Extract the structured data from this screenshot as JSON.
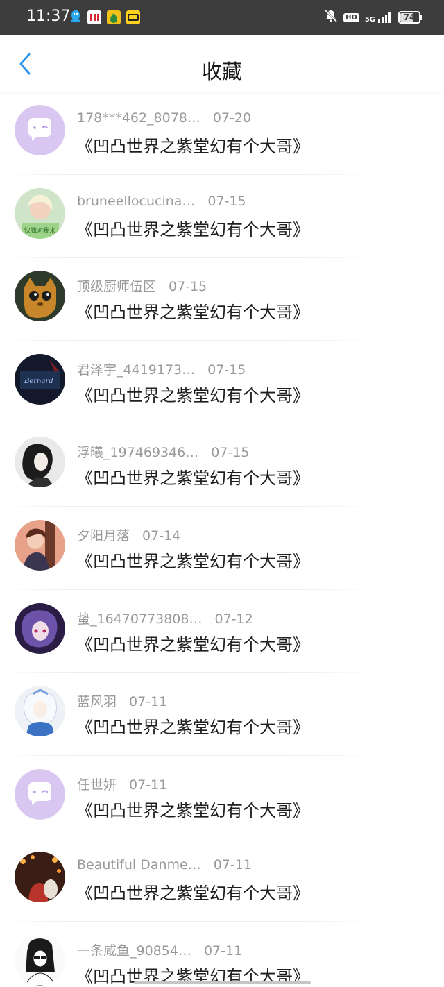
{
  "status_bar": {
    "time": "11:37",
    "hd": "HD",
    "network": "5G",
    "battery": "74",
    "battery_level": 74,
    "app_icons": [
      "qq-icon",
      "kfc-icon",
      "pear-app-icon",
      "kuaikan-icon"
    ]
  },
  "header": {
    "title": "收藏",
    "back_icon": "chevron-left-icon",
    "accent_color": "#2f95e8"
  },
  "list": {
    "items": [
      {
        "user": "178***462_8078…",
        "date": "07-20",
        "book": "《凹凸世界之紫堂幻有个大哥》",
        "avatar": "default-chat-avatar"
      },
      {
        "user": "bruneellocucina…",
        "date": "07-15",
        "book": "《凹凸世界之紫堂幻有个大哥》",
        "avatar": "photo-avatar"
      },
      {
        "user": "顶级厨师伍区",
        "date": "07-15",
        "book": "《凹凸世界之紫堂幻有个大哥》",
        "avatar": "cat-avatar"
      },
      {
        "user": "君泽宇_4419173…",
        "date": "07-15",
        "book": "《凹凸世界之紫堂幻有个大哥》",
        "avatar": "dark-card-avatar"
      },
      {
        "user": "浮曦_197469346…",
        "date": "07-15",
        "book": "《凹凸世界之紫堂幻有个大哥》",
        "avatar": "anime-bw-avatar"
      },
      {
        "user": "夕阳月落",
        "date": "07-14",
        "book": "《凹凸世界之紫堂幻有个大哥》",
        "avatar": "anime-sunset-avatar"
      },
      {
        "user": "蛰_16470773808…",
        "date": "07-12",
        "book": "《凹凸世界之紫堂幻有个大哥》",
        "avatar": "anime-purple-avatar"
      },
      {
        "user": "蓝风羽",
        "date": "07-11",
        "book": "《凹凸世界之紫堂幻有个大哥》",
        "avatar": "anime-white-avatar"
      },
      {
        "user": "任世妍",
        "date": "07-11",
        "book": "《凹凸世界之紫堂幻有个大哥》",
        "avatar": "default-chat-avatar"
      },
      {
        "user": "Beautiful Danme…",
        "date": "07-11",
        "book": "《凹凸世界之紫堂幻有个大哥》",
        "avatar": "lantern-avatar"
      },
      {
        "user": "一条咸鱼_90854…",
        "date": "07-11",
        "book": "《凹凸世界之紫堂幻有个大哥》",
        "avatar": "sketch-avatar"
      }
    ]
  }
}
